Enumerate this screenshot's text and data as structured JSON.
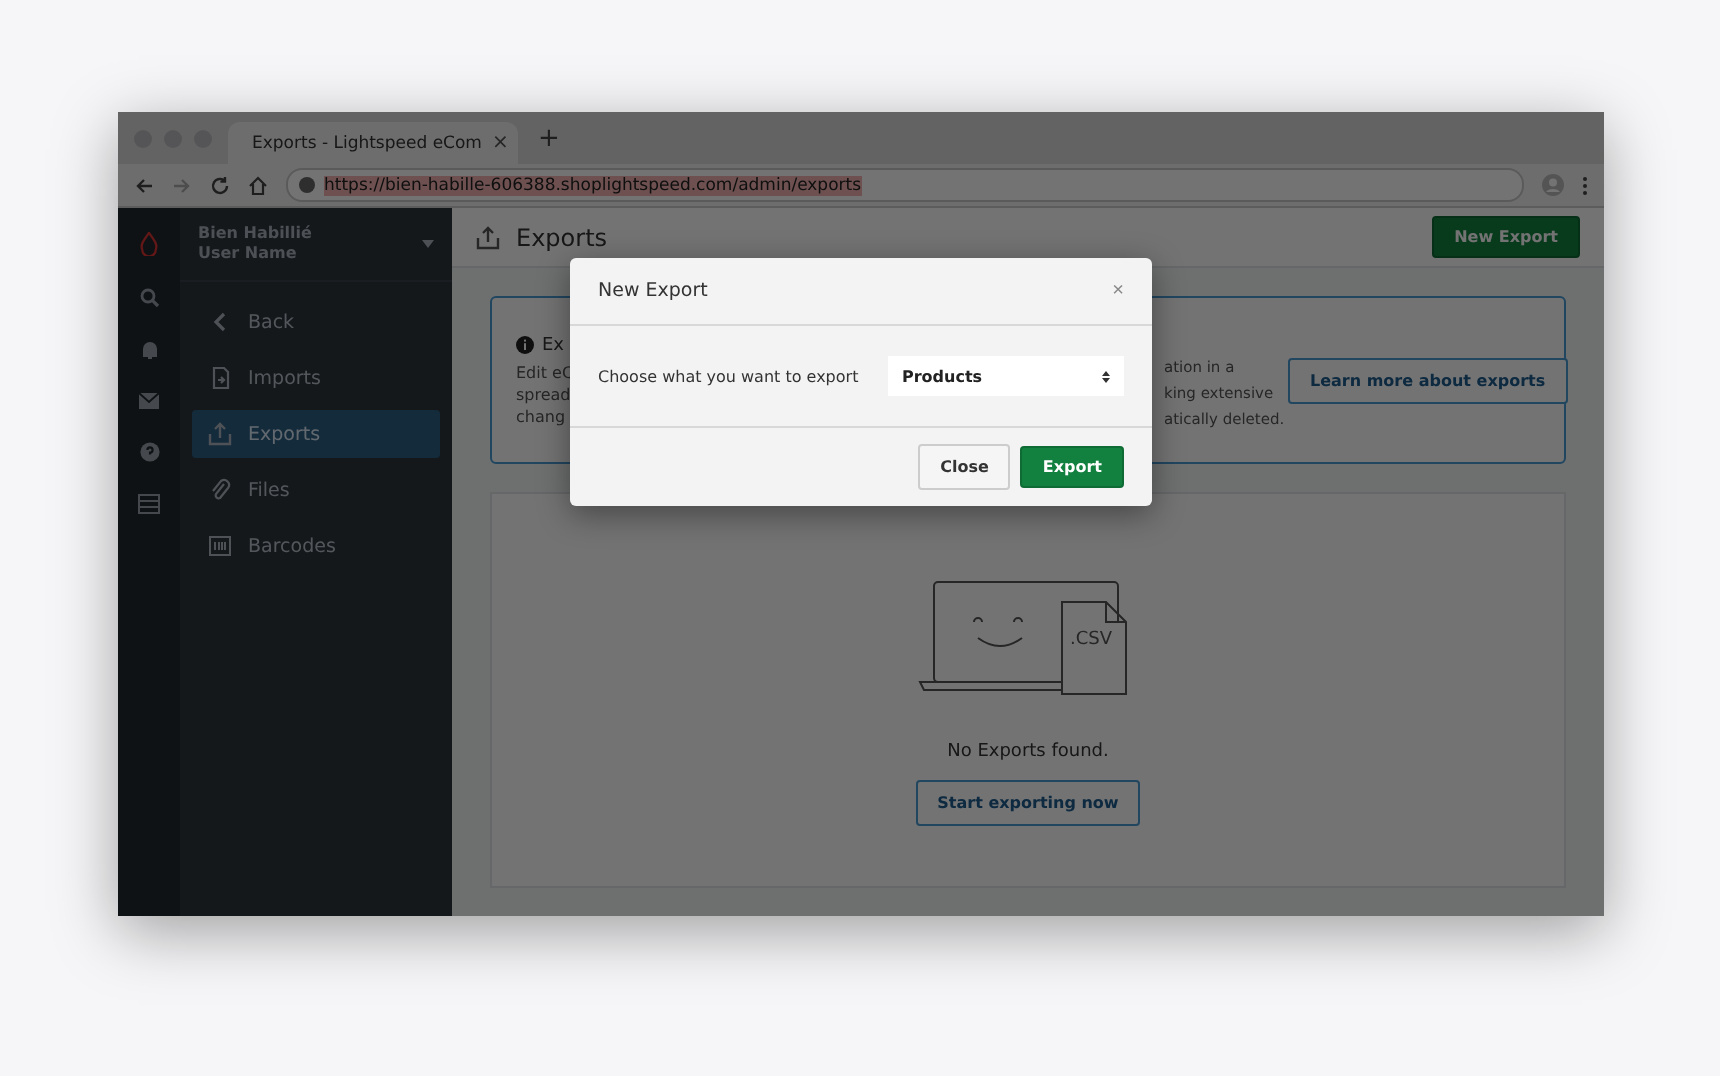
{
  "browser": {
    "tab_title": "Exports - Lightspeed eCom",
    "tab_close": "×",
    "new_tab": "+",
    "url": "https://bien-habille-606388.shoplightspeed.com/admin/exports"
  },
  "sidebar": {
    "store_name": "Bien Habillié",
    "user_name": "User Name",
    "items": [
      {
        "label": "Back",
        "kind": "back",
        "selected": false
      },
      {
        "label": "Imports",
        "kind": "imports",
        "selected": false
      },
      {
        "label": "Exports",
        "kind": "exports",
        "selected": true
      },
      {
        "label": "Files",
        "kind": "files",
        "selected": false
      },
      {
        "label": "Barcodes",
        "kind": "barcodes",
        "selected": false
      }
    ]
  },
  "header": {
    "title": "Exports",
    "new_export": "New Export"
  },
  "info": {
    "title": "Ex",
    "lines_left": [
      "Edit eC",
      "spread",
      "chang"
    ],
    "lines_right": [
      "ation in a",
      "king extensive",
      "atically deleted."
    ],
    "learn_more": "Learn more about exports"
  },
  "empty": {
    "file_label": ".CSV",
    "message": "No Exports found.",
    "button": "Start exporting now"
  },
  "modal": {
    "title": "New Export",
    "close": "×",
    "label": "Choose what you want to export",
    "select_value": "Products",
    "buttons": [
      {
        "label": "Close",
        "kind": "secondary"
      },
      {
        "label": "Export",
        "kind": "primary"
      }
    ]
  }
}
